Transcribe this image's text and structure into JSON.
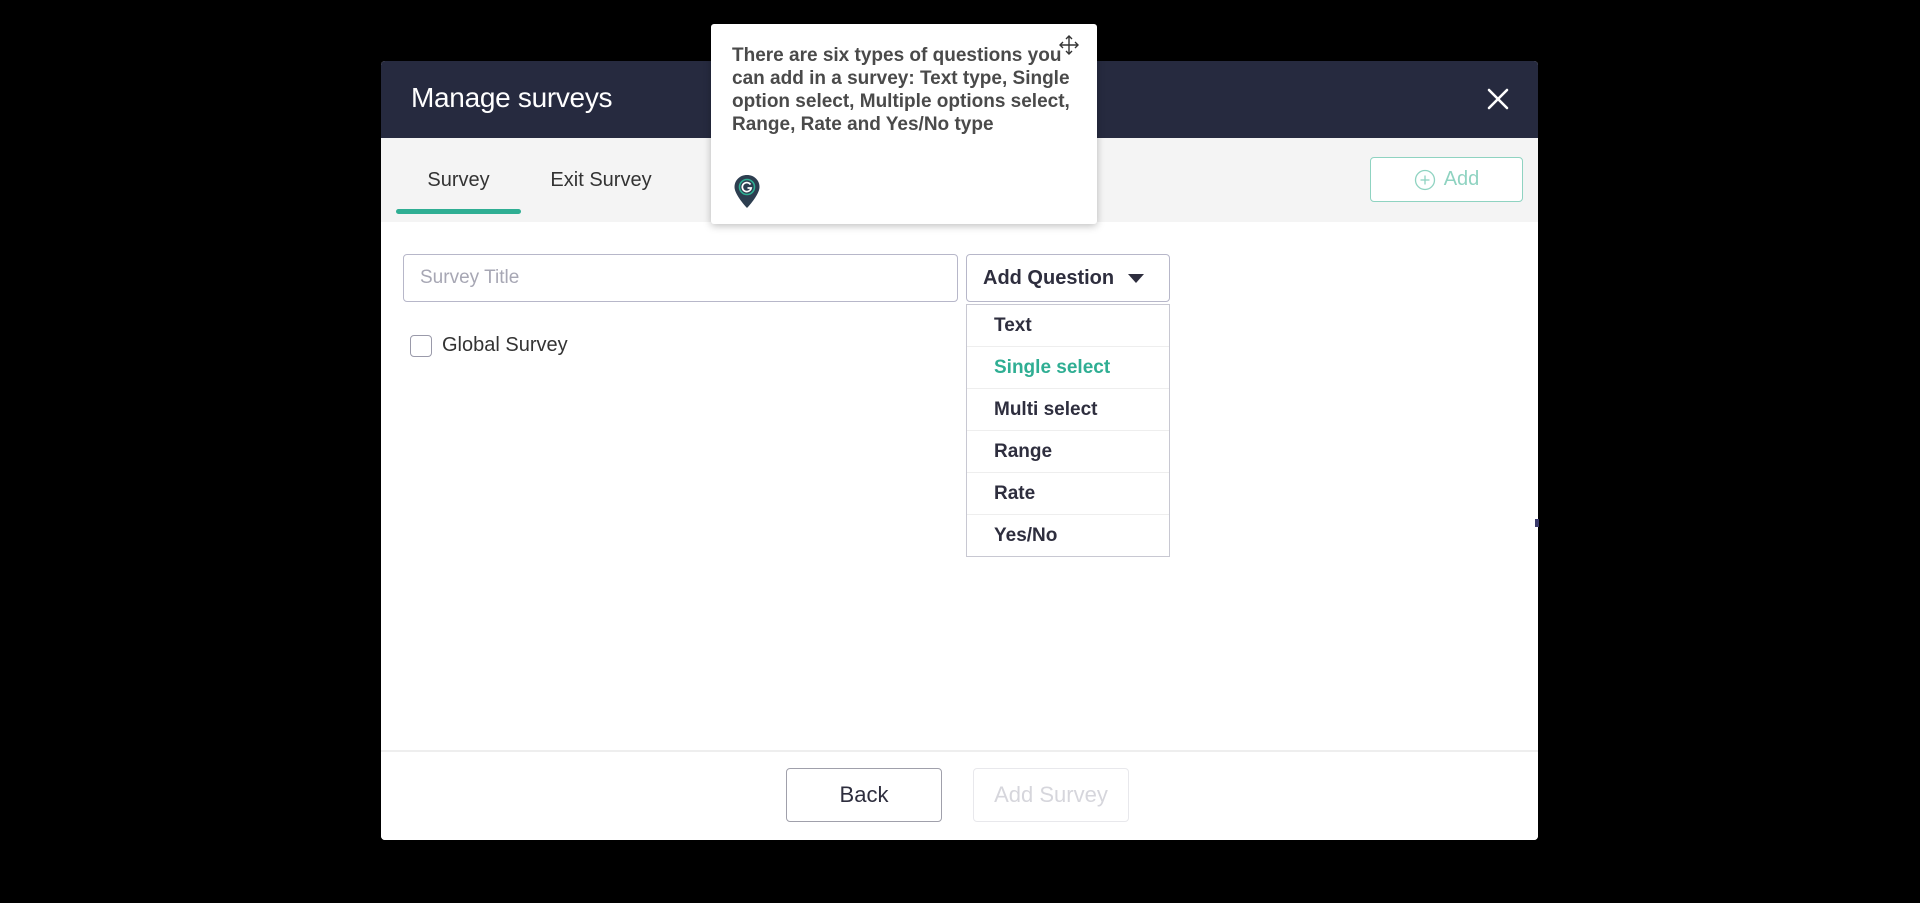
{
  "modal": {
    "title": "Manage surveys",
    "close_icon": "close-icon"
  },
  "tabs": [
    {
      "label": "Survey",
      "active": true
    },
    {
      "label": "Exit Survey",
      "active": false
    }
  ],
  "toolbar": {
    "add_label": "Add",
    "add_icon": "plus-circle-icon"
  },
  "form": {
    "title_placeholder": "Survey Title",
    "title_value": "",
    "add_question_label": "Add Question",
    "global_survey_label": "Global Survey",
    "global_survey_checked": false
  },
  "dropdown": {
    "items": [
      {
        "label": "Text"
      },
      {
        "label": "Single select"
      },
      {
        "label": "Multi select"
      },
      {
        "label": "Range"
      },
      {
        "label": "Rate"
      },
      {
        "label": "Yes/No"
      }
    ],
    "highlighted": "Single select"
  },
  "footer": {
    "back_label": "Back",
    "add_survey_label": "Add Survey"
  },
  "tooltip": {
    "text": "There are six types of questions you can add in a survey: Text type, Single option select, Multiple options select, Range, Rate and Yes/No type",
    "logo_icon": "guide-pin-icon",
    "move_icon": "move-icon"
  },
  "colors": {
    "header_bg": "#262a3f",
    "accent": "#2fae93",
    "page_bg": "#000000"
  }
}
